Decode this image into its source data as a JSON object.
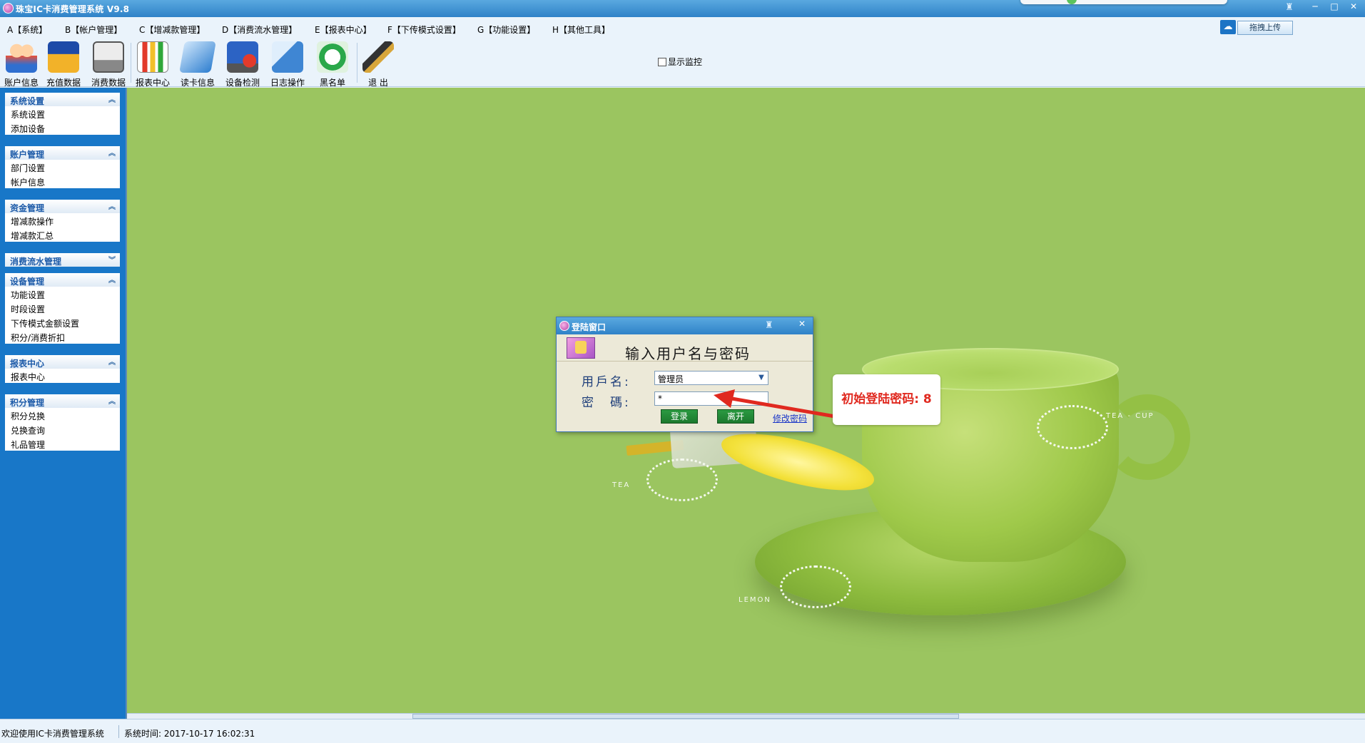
{
  "window": {
    "title": "珠宝IC卡消费管理系统 V9.8",
    "controls": {
      "minimize": "─",
      "maximize": "□",
      "close": "✕"
    }
  },
  "menu": {
    "items": [
      {
        "key": "A",
        "label": "A【系统】"
      },
      {
        "key": "B",
        "label": "B【帐户管理】"
      },
      {
        "key": "C",
        "label": "C【增减款管理】"
      },
      {
        "key": "D",
        "label": "D【消费流水管理】"
      },
      {
        "key": "E",
        "label": "E【报表中心】"
      },
      {
        "key": "F",
        "label": "F【下传模式设置】"
      },
      {
        "key": "G",
        "label": "G【功能设置】"
      },
      {
        "key": "H",
        "label": "H【其他工具】"
      }
    ],
    "upload_button": "拖拽上传"
  },
  "toolbar": {
    "buttons": [
      {
        "label": "账户信息",
        "icon": "accounts-icon"
      },
      {
        "label": "充值数据",
        "icon": "recharge-icon"
      },
      {
        "label": "消费数据",
        "icon": "consumption-icon"
      },
      {
        "label": "报表中心",
        "icon": "report-chart-icon"
      },
      {
        "label": "读卡信息",
        "icon": "read-card-icon"
      },
      {
        "label": "设备检测",
        "icon": "device-check-icon"
      },
      {
        "label": "日志操作",
        "icon": "log-icon"
      },
      {
        "label": "黑名单",
        "icon": "blacklist-icon"
      },
      {
        "label": "退 出",
        "icon": "exit-pen-icon"
      }
    ],
    "monitor_checkbox": {
      "label": "显示监控",
      "checked": false
    }
  },
  "sidebar": {
    "groups": [
      {
        "title": "系统设置",
        "expanded": true,
        "items": [
          "系统设置",
          "添加设备"
        ]
      },
      {
        "title": "账户管理",
        "expanded": true,
        "items": [
          "部门设置",
          "帐户信息"
        ]
      },
      {
        "title": "资金管理",
        "expanded": true,
        "items": [
          "增减款操作",
          "增减款汇总"
        ]
      },
      {
        "title": "消费流水管理",
        "expanded": false,
        "items": []
      },
      {
        "title": "设备管理",
        "expanded": true,
        "items": [
          "功能设置",
          "时段设置",
          "下传模式金额设置",
          "积分/消费折扣"
        ]
      },
      {
        "title": "报表中心",
        "expanded": true,
        "items": [
          "报表中心"
        ]
      },
      {
        "title": "积分管理",
        "expanded": true,
        "items": [
          "积分兑换",
          "兑换查询",
          "礼品管理"
        ]
      }
    ]
  },
  "background": {
    "labels": {
      "tea": "TEA",
      "tea_cup": "TEA - CUP",
      "lemon": "LEMON"
    }
  },
  "login_dialog": {
    "title": "登陆窗口",
    "heading": "输入用户名与密码",
    "username_label": "用戶名:",
    "password_label": "密　碼:",
    "username_value": "管理员",
    "password_value": "*",
    "login_button": "登录",
    "leave_button": "离开",
    "change_password_link": "修改密码"
  },
  "annotation": {
    "text": "初始登陆密码: 8",
    "color": "#e0291f"
  },
  "statusbar": {
    "welcome": "欢迎使用IC卡消费管理系统",
    "time": "系统时间: 2017-10-17 16:02:31"
  }
}
